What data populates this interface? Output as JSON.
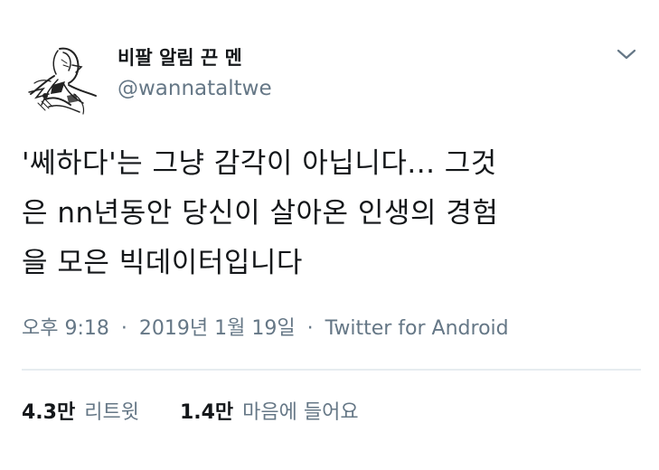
{
  "author": {
    "display_name": "비팔 알림 끈 멘",
    "handle": "@wannataltwe"
  },
  "tweet": {
    "lines": [
      "'쎄하다'는 그냥 감각이 아닙니다... 그것",
      "은 nn년동안 당신이 살아온 인생의 경험",
      "을 모은 빅데이터입니다"
    ],
    "time": "오후 9:18",
    "date": "2019년 1월 19일",
    "source": "Twitter for Android",
    "separator": "·"
  },
  "stats": {
    "retweets_count": "4.3만",
    "retweets_label": "리트윗",
    "likes_count": "1.4만",
    "likes_label": "마음에 들어요"
  },
  "icons": {
    "menu": "chevron-down-icon",
    "avatar": "sketch-avatar"
  },
  "colors": {
    "text": "#14171a",
    "secondary": "#657786",
    "divider": "#e6ecf0"
  }
}
